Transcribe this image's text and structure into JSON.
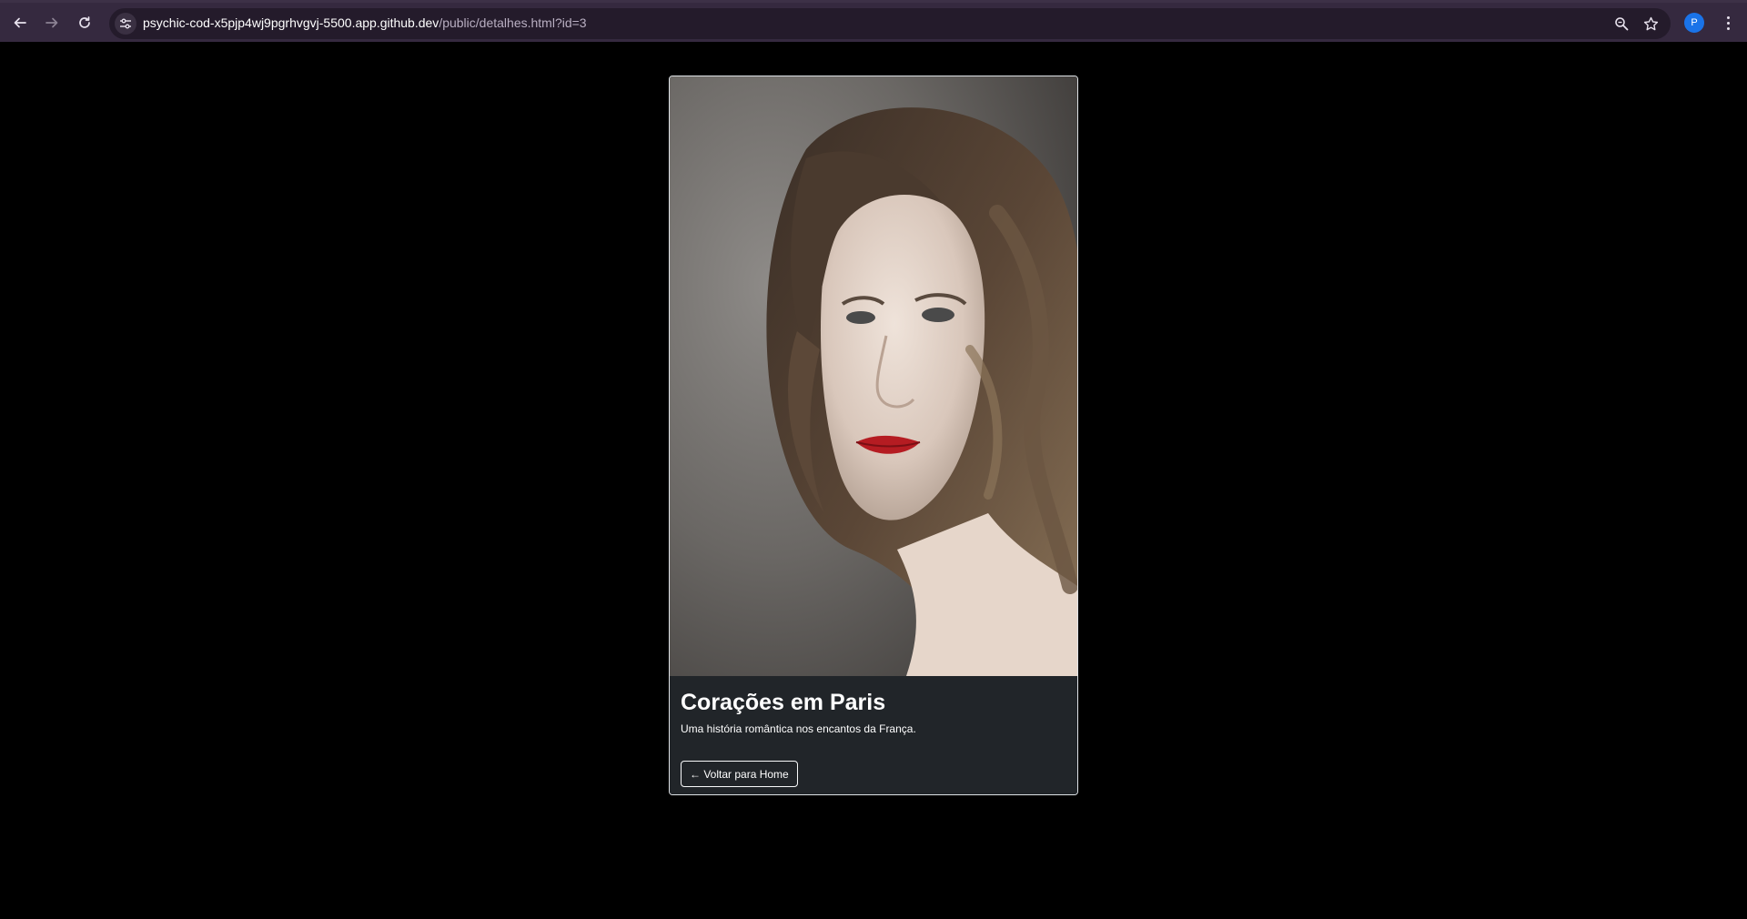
{
  "browser": {
    "url_host": "psychic-cod-x5pjp4wj9pgrhvgvj-5500.app.github.dev",
    "url_path": "/public/detalhes.html?id=3",
    "profile_initial": "P",
    "icons": {
      "back": "arrow-left-icon",
      "forward": "arrow-right-icon",
      "reload": "reload-icon",
      "site_info": "tune-icon",
      "zoom": "zoom-icon",
      "bookmark": "star-icon",
      "menu": "kebab-menu-icon"
    }
  },
  "card": {
    "title": "Corações em Paris",
    "description": "Uma história romântica nos encantos da França.",
    "back_button_label": "← Voltar para Home",
    "image_subject": "portrait-photo"
  },
  "colors": {
    "page_background": "#000000",
    "card_background": "#212529",
    "card_border": "#dee2e6",
    "chrome_background": "#35293f",
    "omnibox_background": "#241b2b",
    "avatar": "#1a73e8"
  }
}
